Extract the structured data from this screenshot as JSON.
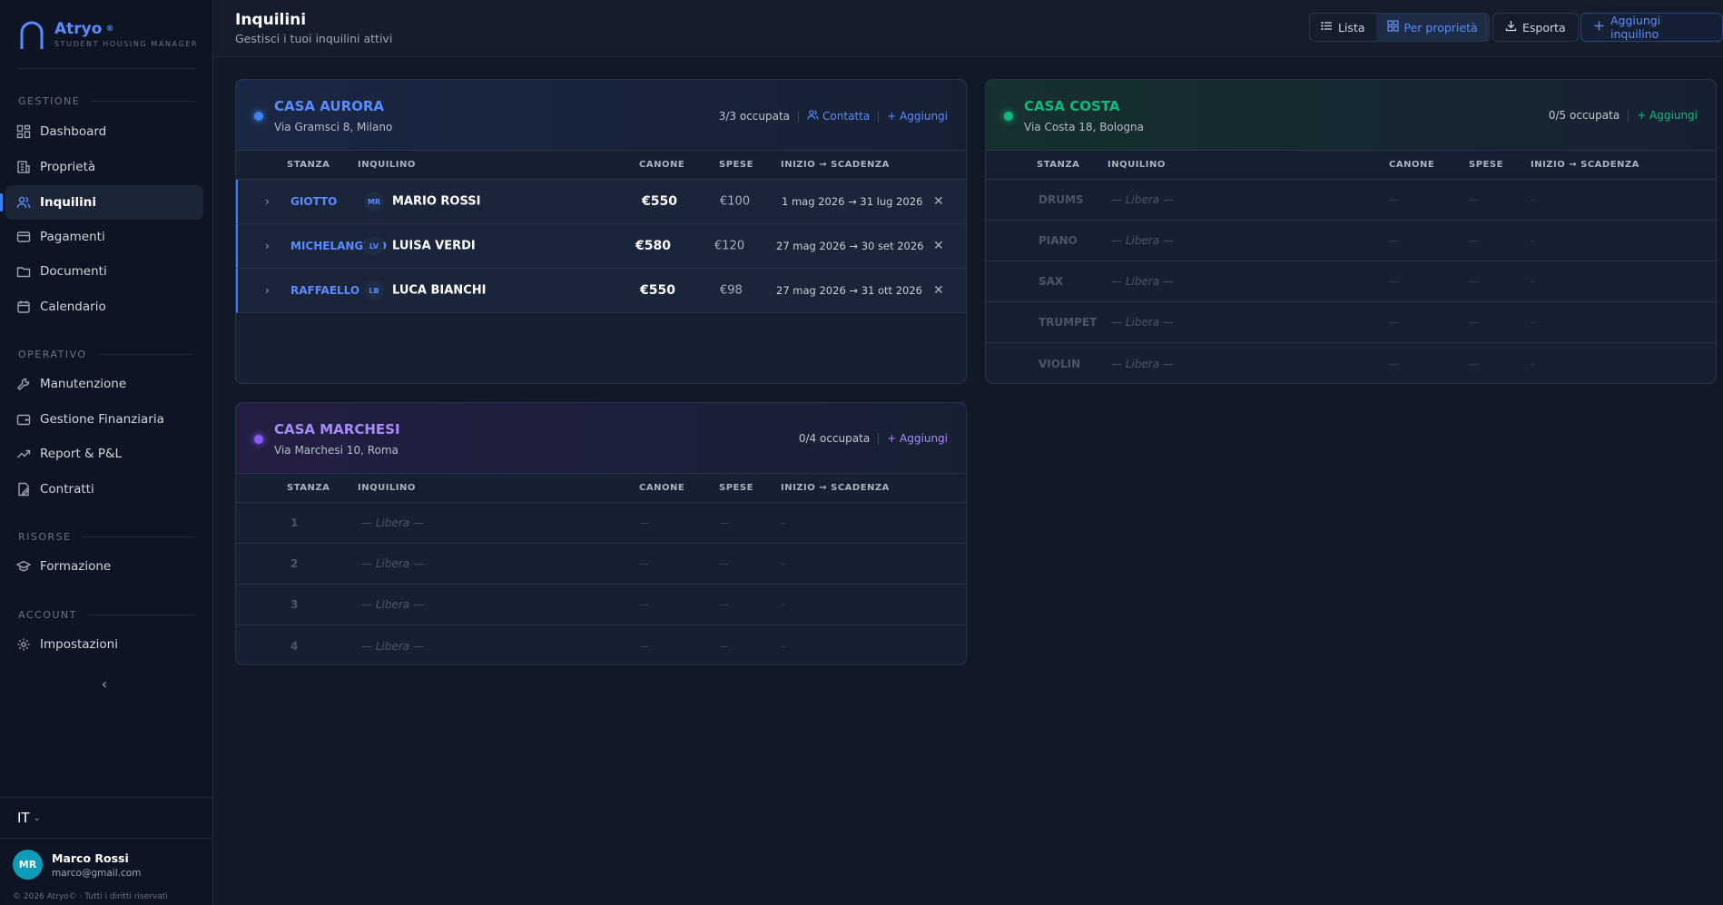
{
  "sidebar": {
    "brand_name": "Atryo",
    "brand_badge": "®",
    "brand_sub": "STUDENT HOUSING MANAGER",
    "sections": {
      "gestione": "GESTIONE",
      "operativo": "OPERATIVO",
      "risorse": "RISORSE",
      "account": "ACCOUNT"
    },
    "items": {
      "dashboard": "Dashboard",
      "proprieta": "Proprietà",
      "inquilini": "Inquilini",
      "pagamenti": "Pagamenti",
      "documenti": "Documenti",
      "calendario": "Calendario",
      "manutenzione": "Manutenzione",
      "finanziaria": "Gestione Finanziaria",
      "report": "Report & P&L",
      "contratti": "Contratti",
      "formazione": "Formazione",
      "impostazioni": "Impostazioni"
    },
    "collapse_glyph": "‹",
    "language": "IT",
    "user": {
      "initials": "MR",
      "name": "Marco Rossi",
      "email": "marco@gmail.com"
    },
    "copyright": "© 2026 Atryo© · Tutti i diritti riservati"
  },
  "header": {
    "title": "Inquilini",
    "subtitle": "Gestisci i tuoi inquilini attivi",
    "view_list": "Lista",
    "view_property": "Per proprietà",
    "export": "Esporta",
    "add_tenant": "Aggiungi inquilino"
  },
  "table_headers": {
    "stanza": "STANZA",
    "inquilino": "INQUILINO",
    "canone": "CANONE",
    "spese": "SPESE",
    "periodo": "INIZIO → SCADENZA"
  },
  "properties": {
    "aurora": {
      "name": "CASA AURORA",
      "address": "Via Gramsci 8, Milano",
      "occupancy": "3/3 occupata",
      "contact": "Contatta",
      "add": "+ Aggiungi",
      "accent": "#3b82f6",
      "rows": [
        {
          "room": "GIOTTO",
          "initials": "MR",
          "tenant": "MARIO ROSSI",
          "canone": "€550",
          "spese": "€100",
          "dates": "1 mag 2026 → 31 lug 2026"
        },
        {
          "room": "MICHELANGELO",
          "initials": "LV",
          "tenant": "LUISA VERDI",
          "canone": "€580",
          "spese": "€120",
          "dates": "27 mag 2026 → 30 set 2026"
        },
        {
          "room": "RAFFAELLO",
          "initials": "LB",
          "tenant": "LUCA BIANCHI",
          "canone": "€550",
          "spese": "€98",
          "dates": "27 mag 2026 → 31 ott 2026"
        }
      ]
    },
    "costa": {
      "name": "CASA COSTA",
      "address": "Via Costa 18, Bologna",
      "occupancy": "0/5 occupata",
      "add": "+ Aggiungi",
      "accent": "#10b981",
      "rows": [
        {
          "room": "DRUMS",
          "tenant": "— Libera —"
        },
        {
          "room": "PIANO",
          "tenant": "— Libera —"
        },
        {
          "room": "SAX",
          "tenant": "— Libera —"
        },
        {
          "room": "TRUMPET",
          "tenant": "— Libera —"
        },
        {
          "room": "VIOLIN",
          "tenant": "— Libera —"
        }
      ]
    },
    "marchesi": {
      "name": "CASA MARCHESI",
      "address": "Via Marchesi 10, Roma",
      "occupancy": "0/4 occupata",
      "add": "+ Aggiungi",
      "accent": "#8b5cf6",
      "rows": [
        {
          "room": "1",
          "tenant": "— Libera —"
        },
        {
          "room": "2",
          "tenant": "— Libera —"
        },
        {
          "room": "3",
          "tenant": "— Libera —"
        },
        {
          "room": "4",
          "tenant": "— Libera —"
        }
      ]
    }
  },
  "placeholders": {
    "dash": "—",
    "dash_short": "–"
  },
  "colors": {
    "primary": "#5b8cff",
    "green": "#10b981",
    "purple": "#8b5cf6"
  }
}
